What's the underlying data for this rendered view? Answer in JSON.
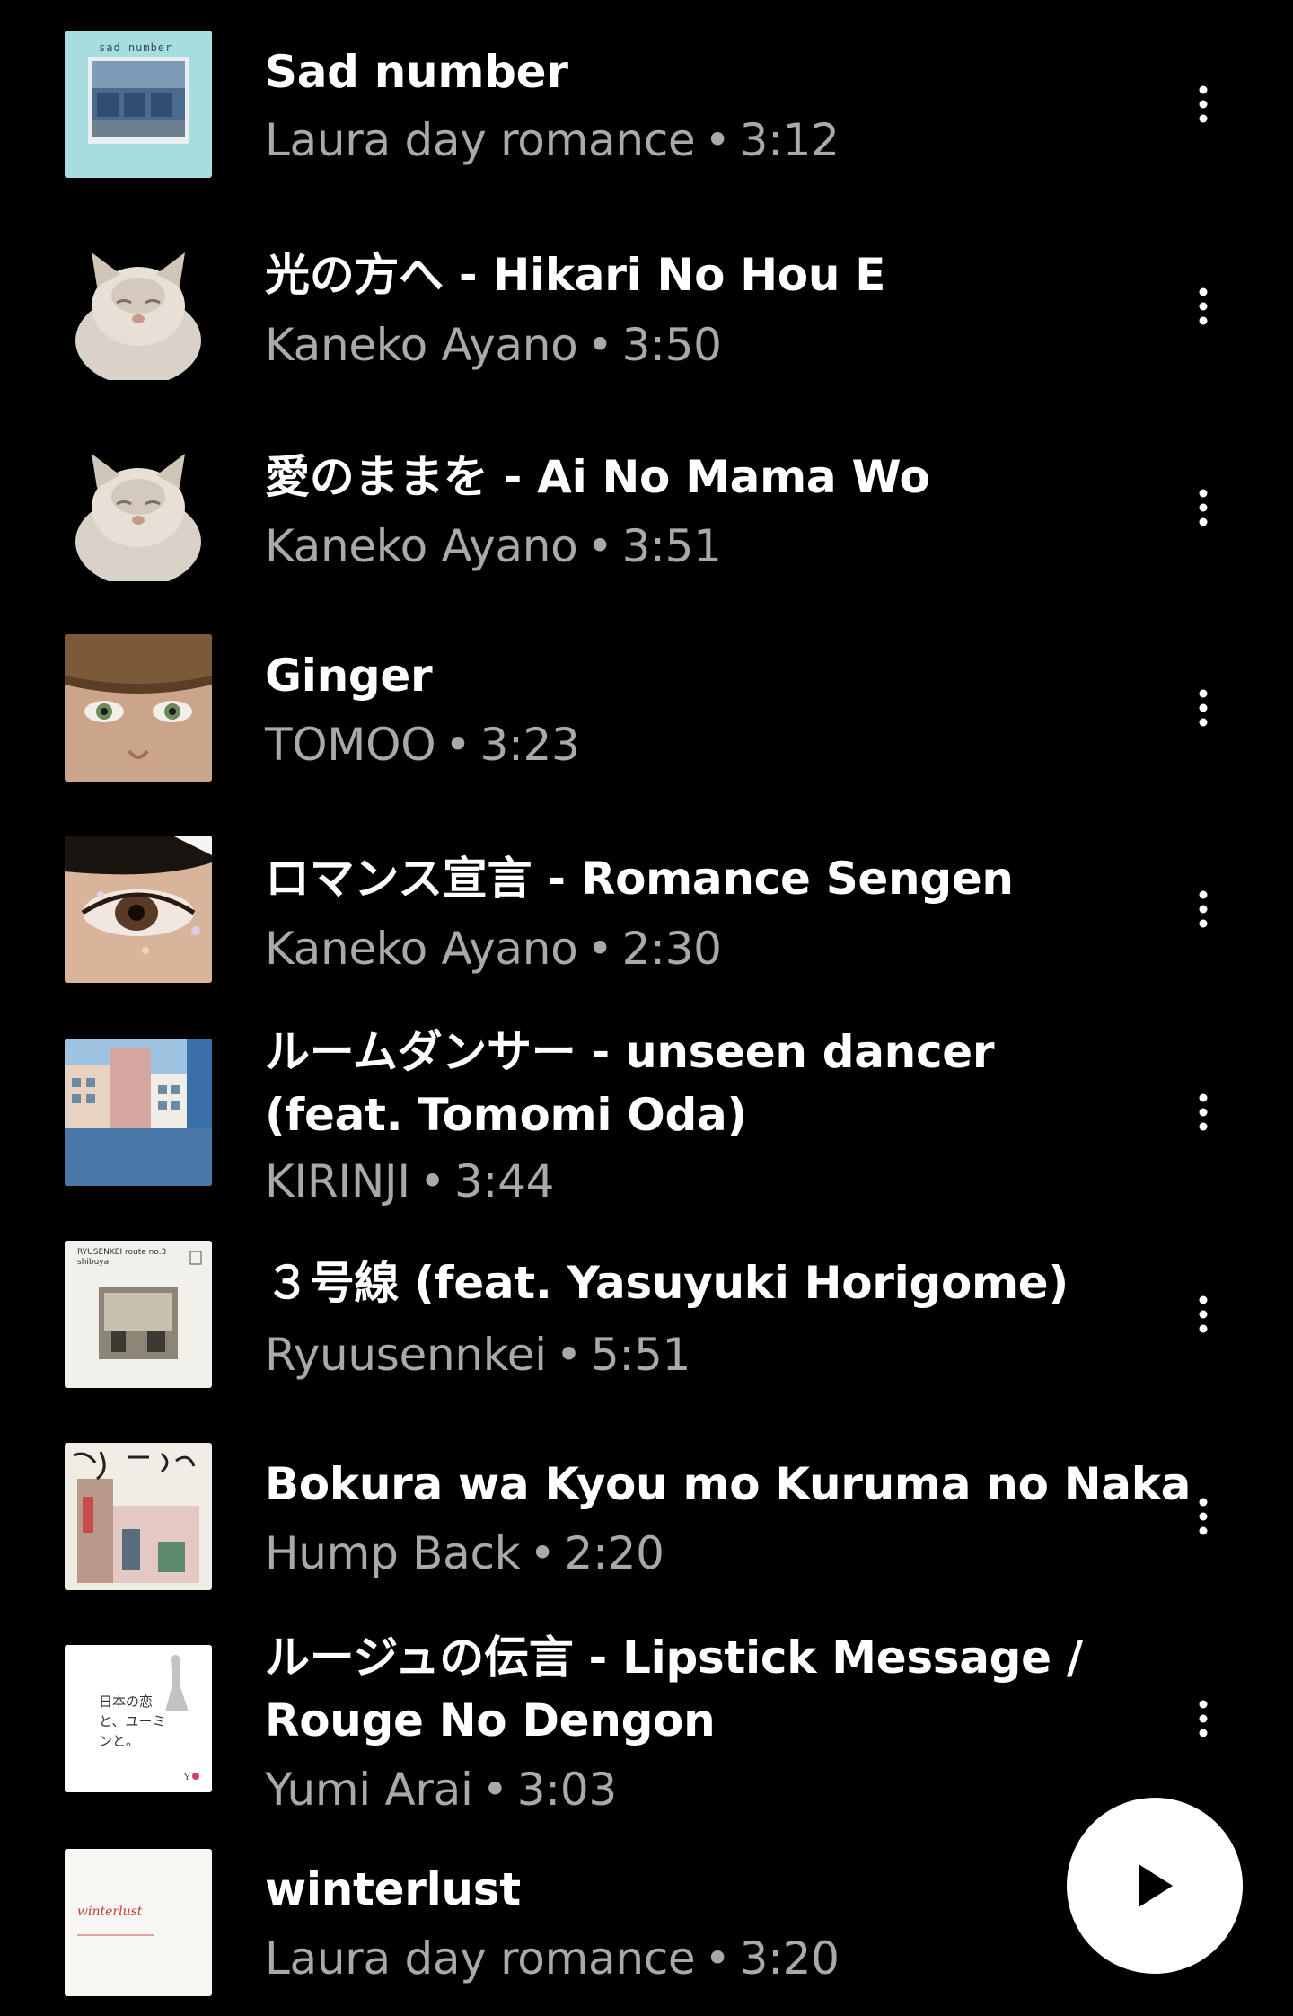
{
  "tracks": [
    {
      "title": "Sad number",
      "artist": "Laura day romance",
      "duration": "3:12",
      "art": "sad-number-album-art",
      "art_text": "sad number"
    },
    {
      "title": "光の方へ - Hikari No Hou E",
      "artist": "Kaneko Ayano",
      "duration": "3:50",
      "art": "cat-album-art"
    },
    {
      "title": "愛のままを - Ai No Mama Wo",
      "artist": "Kaneko Ayano",
      "duration": "3:51",
      "art": "cat-album-art"
    },
    {
      "title": "Ginger",
      "artist": "TOMOO",
      "duration": "3:23",
      "art": "eyes-album-art"
    },
    {
      "title": "ロマンス宣言 - Romance Sengen",
      "artist": "Kaneko Ayano",
      "duration": "2:30",
      "art": "eye-closeup-album-art"
    },
    {
      "title": "ルームダンサー - unseen dancer (feat. Tomomi Oda)",
      "artist": "KIRINJI",
      "duration": "3:44",
      "art": "buildings-album-art"
    },
    {
      "title": "３号線 (feat. Yasuyuki Horigome)",
      "artist": "Ryuusennkei",
      "duration": "5:51",
      "art": "route-no3-album-art",
      "art_text": "RYUSENKEI route no.3 shibuya"
    },
    {
      "title": "Bokura wa Kyou mo Kuruma no Naka",
      "artist": "Hump Back",
      "duration": "2:20",
      "art": "street-album-art"
    },
    {
      "title": "ルージュの伝言 - Lipstick Message / Rouge No Dengon",
      "artist": "Yumi Arai",
      "duration": "3:03",
      "art": "yuming-album-art",
      "art_text": "日本の恋と、ユーミンと。"
    },
    {
      "title": "winterlust",
      "artist": "Laura day romance",
      "duration": "3:20",
      "art": "winterlust-album-art",
      "art_text": "winterlust"
    }
  ],
  "separator": "•",
  "colors": {
    "background": "#000000",
    "title": "#ffffff",
    "subtitle": "#a9a9a9",
    "fab": "#ffffff"
  },
  "icons": {
    "more": "more-vert-icon",
    "play": "play-icon"
  }
}
